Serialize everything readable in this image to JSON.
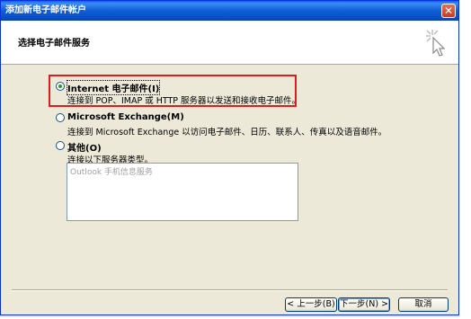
{
  "window": {
    "title": "添加新电子邮件帐户",
    "close_symbol": "✕"
  },
  "header": {
    "title": "选择电子邮件服务",
    "icon": "wizard-cursor-icon"
  },
  "options": [
    {
      "label": "Internet 电子邮件(I)",
      "description": "连接到 POP、IMAP 或 HTTP 服务器以发送和接收电子邮件。",
      "selected": true
    },
    {
      "label": "Microsoft Exchange(M)",
      "description": "连接到 Microsoft Exchange 以访问电子邮件、日历、联系人、传真以及语音邮件。",
      "selected": false
    },
    {
      "label": "其他(O)",
      "description": "连接以下服务器类型。",
      "selected": false
    }
  ],
  "other_server_list": {
    "items": [
      "Outlook 手机信息服务"
    ]
  },
  "buttons": {
    "back": "< 上一步(B)",
    "next": "下一步(N) >",
    "cancel": "取消"
  },
  "colors": {
    "titlebar": "#0a4fc7",
    "highlight": "#e01b1b",
    "dialog_bg": "#ece9d8",
    "radio_dot": "#21a121"
  }
}
